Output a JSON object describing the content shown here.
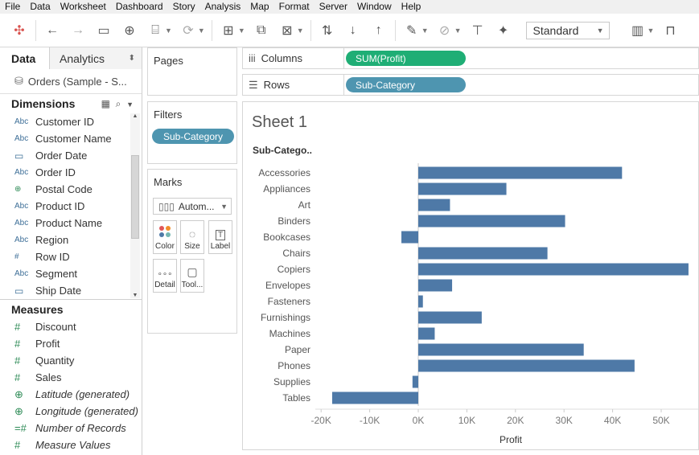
{
  "menu": [
    "File",
    "Data",
    "Worksheet",
    "Dashboard",
    "Story",
    "Analysis",
    "Map",
    "Format",
    "Server",
    "Window",
    "Help"
  ],
  "toolbar": {
    "icons": [
      "tableau-logo-icon",
      "undo-icon",
      "redo-icon",
      "save-icon",
      "new-datasource-icon",
      "pause-updates-icon",
      "refresh-icon",
      "new-worksheet-icon",
      "duplicate-icon",
      "clear-sheet-icon",
      "swap-icon",
      "sort-ascending-icon",
      "sort-descending-icon",
      "highlight-icon",
      "group-icon",
      "show-labels-icon",
      "pin-icon",
      "show-me-icon",
      "presentation-icon"
    ],
    "fit_value": "Standard"
  },
  "data_pane": {
    "tab_data": "Data",
    "tab_analytics": "Analytics",
    "datasource": "Orders (Sample - S...",
    "dimensions_header": "Dimensions",
    "dimensions": [
      {
        "type": "Abc",
        "name": "Customer ID"
      },
      {
        "type": "Abc",
        "name": "Customer Name"
      },
      {
        "type": "date",
        "name": "Order Date"
      },
      {
        "type": "Abc",
        "name": "Order ID"
      },
      {
        "type": "geo",
        "name": "Postal Code"
      },
      {
        "type": "Abc",
        "name": "Product ID"
      },
      {
        "type": "Abc",
        "name": "Product Name"
      },
      {
        "type": "Abc",
        "name": "Region"
      },
      {
        "type": "#",
        "name": "Row ID"
      },
      {
        "type": "Abc",
        "name": "Segment"
      },
      {
        "type": "date",
        "name": "Ship Date"
      }
    ],
    "measures_header": "Measures",
    "measures": [
      {
        "type": "#",
        "name": "Discount",
        "italic": false
      },
      {
        "type": "#",
        "name": "Profit",
        "italic": false
      },
      {
        "type": "#",
        "name": "Quantity",
        "italic": false
      },
      {
        "type": "#",
        "name": "Sales",
        "italic": false
      },
      {
        "type": "geo",
        "name": "Latitude (generated)",
        "italic": true
      },
      {
        "type": "geo",
        "name": "Longitude (generated)",
        "italic": true
      },
      {
        "type": "=#",
        "name": "Number of Records",
        "italic": true
      },
      {
        "type": "#",
        "name": "Measure Values",
        "italic": true
      }
    ]
  },
  "cards": {
    "pages_title": "Pages",
    "filters_title": "Filters",
    "filter_pill": "Sub-Category",
    "marks_title": "Marks",
    "mark_type": "Autom...",
    "mark_buttons": [
      "Color",
      "Size",
      "Label",
      "Detail",
      "Tool..."
    ]
  },
  "shelves": {
    "columns_label": "Columns",
    "columns_pill": "SUM(Profit)",
    "rows_label": "Rows",
    "rows_pill": "Sub-Category"
  },
  "sheet": {
    "title": "Sheet 1"
  },
  "colors": {
    "bar": "#4e79a7",
    "dimension_pill": "#4e95b0",
    "measure_pill": "#1fae75"
  },
  "chart_data": {
    "type": "bar",
    "orientation": "horizontal",
    "row_header": "Sub-Catego..",
    "categories": [
      "Accessories",
      "Appliances",
      "Art",
      "Binders",
      "Bookcases",
      "Chairs",
      "Copiers",
      "Envelopes",
      "Fasteners",
      "Furnishings",
      "Machines",
      "Paper",
      "Phones",
      "Supplies",
      "Tables"
    ],
    "values": [
      41937,
      18138,
      6528,
      30222,
      -3473,
      26590,
      55618,
      6964,
      950,
      13059,
      3385,
      34054,
      44516,
      -1189,
      -17725
    ],
    "xlabel": "Profit",
    "xlim": [
      -20000,
      55618
    ],
    "xticks": [
      -20000,
      -10000,
      0,
      10000,
      20000,
      30000,
      40000,
      50000
    ],
    "xtick_labels": [
      "-20K",
      "-10K",
      "0K",
      "10K",
      "20K",
      "30K",
      "40K",
      "50K"
    ],
    "grid": false
  }
}
